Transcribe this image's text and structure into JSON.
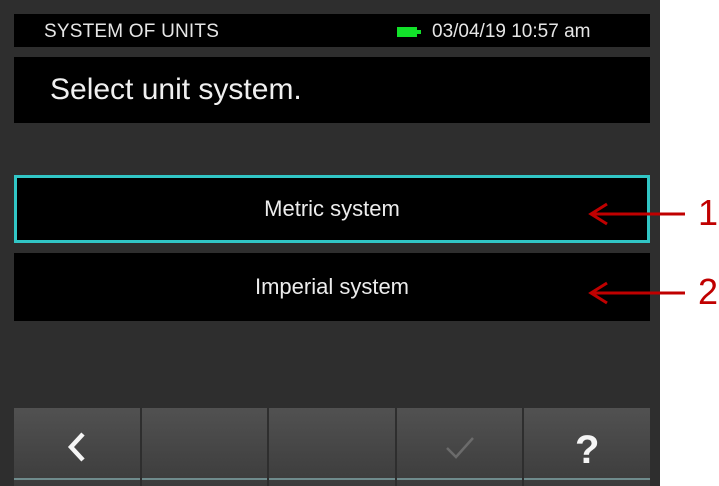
{
  "status_bar": {
    "title": "SYSTEM OF UNITS",
    "battery_icon": "battery-icon",
    "battery_color": "#12e12a",
    "datetime": "03/04/19 10:57 am"
  },
  "header": {
    "prompt": "Select unit system."
  },
  "options": [
    {
      "label": "Metric system",
      "selected": true
    },
    {
      "label": "Imperial system",
      "selected": false
    }
  ],
  "softkeys": [
    {
      "icon": "back-chevron-icon",
      "label": "<"
    },
    {
      "icon": "",
      "label": ""
    },
    {
      "icon": "",
      "label": ""
    },
    {
      "icon": "checkmark-icon",
      "enabled": false
    },
    {
      "icon": "help-icon",
      "label": "?"
    }
  ],
  "callouts": [
    {
      "number": "1",
      "target": "Metric system"
    },
    {
      "number": "2",
      "target": "Imperial system"
    }
  ],
  "colors": {
    "selection_border": "#31c6c6",
    "callout": "#c00000",
    "background": "#2e2e2e"
  }
}
